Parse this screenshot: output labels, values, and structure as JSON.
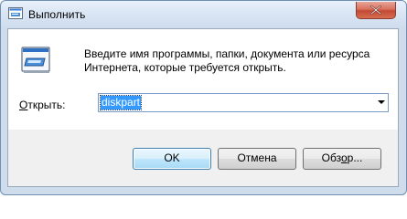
{
  "window": {
    "title": "Выполнить"
  },
  "main": {
    "description_line1": "Введите имя программы, папки, документа или ресурса",
    "description_line2": "Интернета, которые требуется открыть.",
    "open_label_accel": "О",
    "open_label_rest": "ткрыть:",
    "open_input_value": "diskpart"
  },
  "buttons": {
    "ok_label": "OK",
    "cancel_label": "Отмена",
    "browse_label_prefix": "Обз",
    "browse_label_accel": "о",
    "browse_label_suffix": "р..."
  },
  "icons": {
    "app": "run-icon",
    "close": "close-icon",
    "dropdown": "chevron-down-icon"
  },
  "colors": {
    "selection": "#3399ff",
    "close_button": "#c34a35",
    "default_button_border": "#3c7fb1"
  }
}
